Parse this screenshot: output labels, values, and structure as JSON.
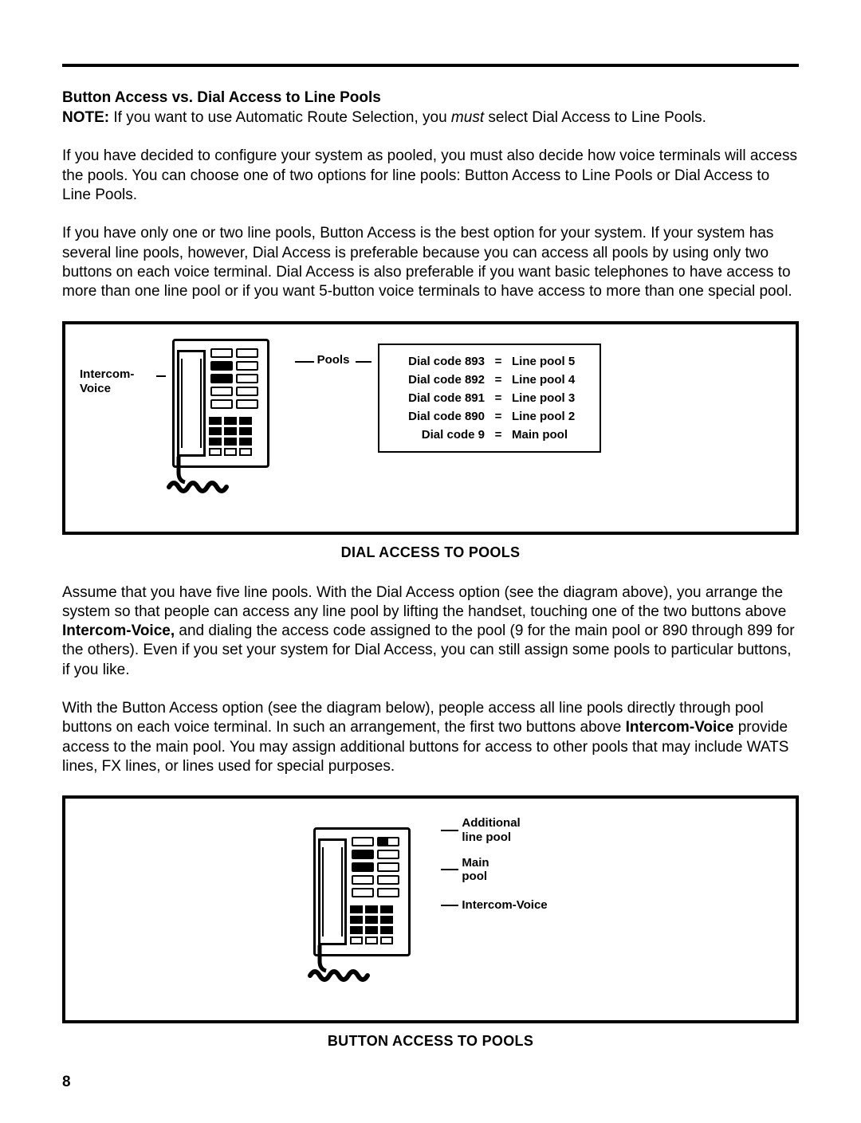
{
  "heading": "Button Access vs. Dial Access to Line Pools",
  "note_label": "NOTE:",
  "note_text_a": " If you want to use Automatic Route Selection, you ",
  "note_italic": "must",
  "note_text_b": " select Dial Access to Line Pools.",
  "para1": "If you have decided to configure your system as pooled, you must also decide how voice terminals will access the pools. You can choose one of two options for line pools: Button Access to Line Pools or Dial Access to Line Pools.",
  "para2": "If you have only one or two line pools, Button Access is the best option for your system. If your system has several line pools, however, Dial Access is preferable because you can access all pools by using only two buttons on each voice terminal. Dial Access is also preferable if you want basic telephones to have access to more than one line pool or if you want 5-button voice terminals to have access to more than one special pool.",
  "fig1": {
    "left_label": "Intercom-\nVoice",
    "pools_label": "Pools",
    "rows": [
      {
        "code": "Dial code 893",
        "eq": "=",
        "pool": "Line pool 5"
      },
      {
        "code": "Dial code 892",
        "eq": "=",
        "pool": "Line pool 4"
      },
      {
        "code": "Dial code 891",
        "eq": "=",
        "pool": "Line pool 3"
      },
      {
        "code": "Dial code 890",
        "eq": "=",
        "pool": "Line pool 2"
      },
      {
        "code": "Dial code 9",
        "eq": "=",
        "pool": "Main pool"
      }
    ],
    "caption": "DIAL ACCESS TO POOLS"
  },
  "para3a": "Assume that you have five line pools. With the Dial Access option (see the diagram above), you arrange the system so that people can access any line pool by lifting the handset, touching one of the two buttons above ",
  "para3_bold": "Intercom-Voice,",
  "para3b": " and dialing the access code assigned to the pool (9 for the main pool or 890 through 899 for the others). Even if you set your system for Dial Access, you can still assign some pools to particular buttons, if you like.",
  "para4a": "With the Button Access option (see the diagram below), people access all line pools directly through pool buttons on each voice terminal. In such an arrangement, the first two buttons above ",
  "para4_bold": "Intercom-Voice",
  "para4b": " provide access to the main pool. You may assign additional buttons for access to other pools that may include WATS lines, FX lines, or lines used for special purposes.",
  "fig2": {
    "ann1": "Additional\nline pool",
    "ann2": "Main\npool",
    "ann3": "Intercom-Voice",
    "caption": "BUTTON ACCESS TO POOLS"
  },
  "page_number": "8"
}
